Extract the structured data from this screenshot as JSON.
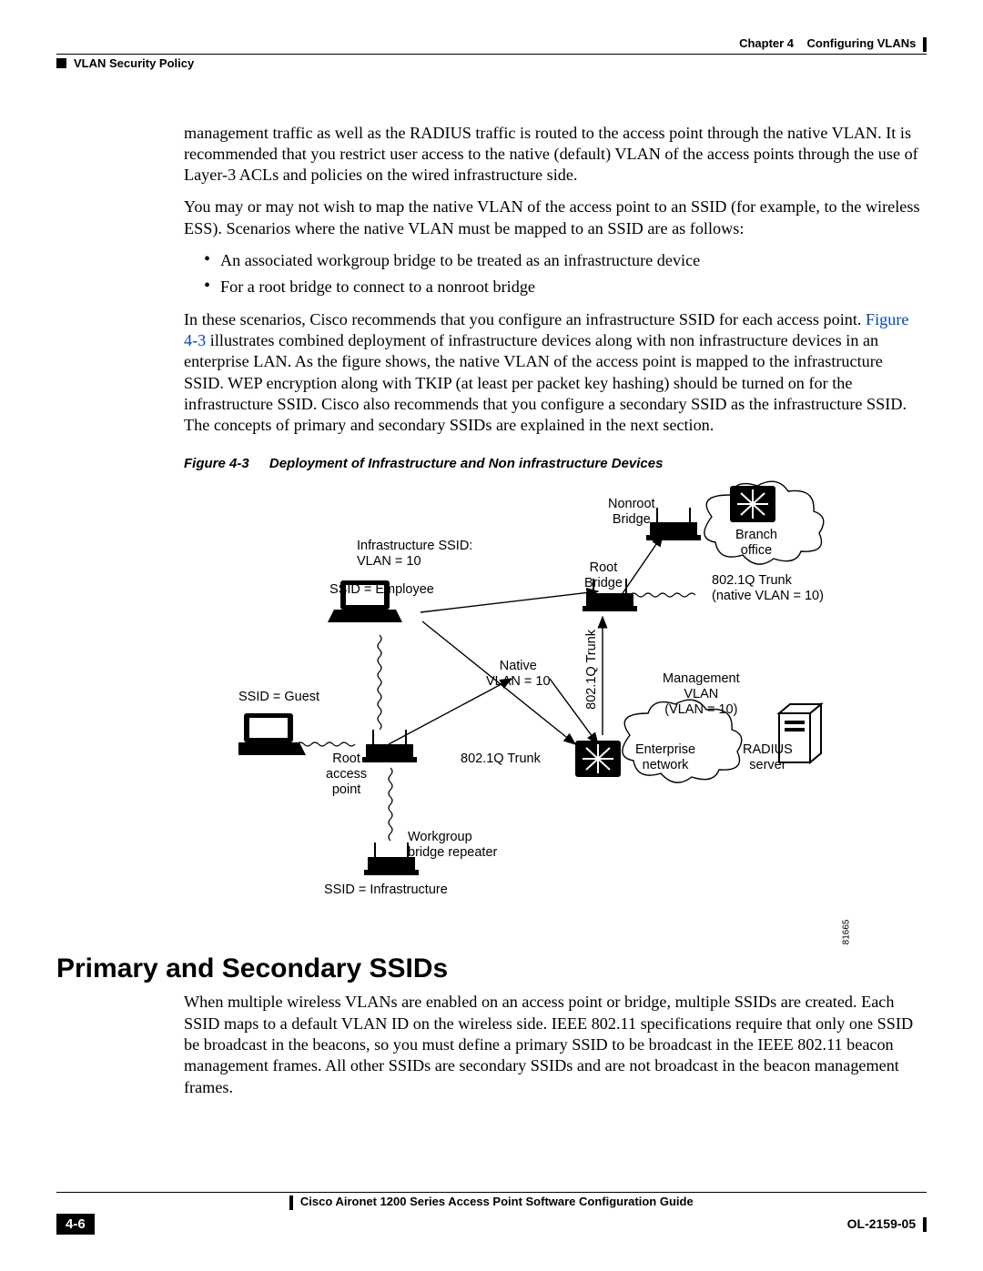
{
  "header": {
    "chapter_label": "Chapter 4",
    "chapter_title": "Configuring VLANs",
    "section": "VLAN Security Policy"
  },
  "para1": "management traffic as well as the RADIUS traffic is routed to the access point through the native VLAN. It is recommended that you restrict user access to the native (default) VLAN of the access points through the use of Layer-3 ACLs and policies on the wired infrastructure side.",
  "para2": "You may or may not wish to map the native VLAN of the access point to an SSID (for example, to the wireless ESS). Scenarios where the native VLAN must be mapped to an SSID are as follows:",
  "bullets": [
    "An associated workgroup bridge to be treated as an infrastructure device",
    "For a root bridge to connect to a nonroot bridge"
  ],
  "para3a": "In these scenarios, Cisco recommends that you configure an infrastructure SSID for each access point. ",
  "figref": "Figure 4-3",
  "para3b": " illustrates combined deployment of infrastructure devices along with non infrastructure devices in an enterprise LAN. As the figure shows, the native VLAN of the access point is mapped to the infrastructure SSID. WEP encryption along with TKIP (at least per packet key hashing) should be turned on for the infrastructure SSID. Cisco also recommends that you configure a secondary SSID as the infrastructure SSID. The concepts of primary and secondary SSIDs are explained in the next section.",
  "figure": {
    "num": "Figure 4-3",
    "title": "Deployment of Infrastructure and Non infrastructure Devices",
    "labels": {
      "nonroot_bridge": "Nonroot\nBridge",
      "branch_office": "Branch\noffice",
      "infra_ssid": "Infrastructure SSID:\nVLAN = 10",
      "ssid_employee": "SSID = Employee",
      "root_bridge": "Root\nBridge",
      "trunk_native": "802.1Q Trunk\n(native VLAN = 10)",
      "ssid_guest": "SSID = Guest",
      "native_vlan": "Native\nVLAN = 10",
      "trunk_vert": "802.1Q Trunk",
      "mgmt_vlan": "Management\nVLAN\n(VLAN = 10)",
      "root_ap": "Root\naccess\npoint",
      "trunk_horiz": "802.1Q Trunk",
      "enterprise": "Enterprise\nnetwork",
      "radius": "RADIUS\nserver",
      "wgb": "Workgroup\nbridge repeater",
      "ssid_infra": "SSID = Infrastructure",
      "imgnum": "81665"
    }
  },
  "heading2": "Primary and Secondary SSIDs",
  "para4": "When multiple wireless VLANs are enabled on an access point or bridge, multiple SSIDs are created. Each SSID maps to a default VLAN ID on the wireless side. IEEE 802.11 specifications require that only one SSID be broadcast in the beacons, so you must define a primary SSID to be broadcast in the IEEE 802.11 beacon management frames. All other SSIDs are secondary SSIDs and are not broadcast in the beacon management frames.",
  "footer": {
    "guide": "Cisco Aironet 1200 Series Access Point Software Configuration Guide",
    "page": "4-6",
    "docnum": "OL-2159-05"
  }
}
